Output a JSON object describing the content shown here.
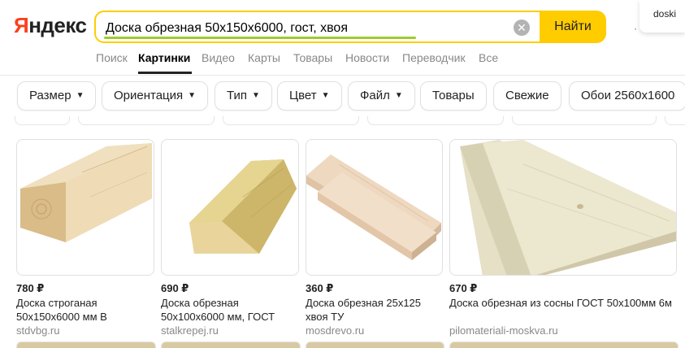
{
  "header": {
    "logo": {
      "first_letter": "Я",
      "rest": "ндекс"
    },
    "search": {
      "value": "Доска обрезная 50х150х6000, гост, хвоя",
      "clear_glyph": "✕",
      "submit_label": "Найти"
    },
    "suggestion": "doski"
  },
  "tabs": [
    {
      "label": "Поиск"
    },
    {
      "label": "Картинки",
      "active": true
    },
    {
      "label": "Видео"
    },
    {
      "label": "Карты"
    },
    {
      "label": "Товары"
    },
    {
      "label": "Новости"
    },
    {
      "label": "Переводчик"
    },
    {
      "label": "Все"
    }
  ],
  "filters": [
    {
      "label": "Размер",
      "dropdown": true
    },
    {
      "label": "Ориентация",
      "dropdown": true
    },
    {
      "label": "Тип",
      "dropdown": true
    },
    {
      "label": "Цвет",
      "dropdown": true
    },
    {
      "label": "Файл",
      "dropdown": true
    },
    {
      "label": "Товары",
      "dropdown": false
    },
    {
      "label": "Свежие",
      "dropdown": false
    },
    {
      "label": "Обои 2560x1600",
      "dropdown": false
    }
  ],
  "results": [
    {
      "price": "780 ₽",
      "title": "Доска строганая 50x150x6000 мм В",
      "domain": "stdvbg.ru"
    },
    {
      "price": "690 ₽",
      "title": "Доска обрезная 50x100x6000 мм, ГОСТ",
      "domain": "stalkrepej.ru"
    },
    {
      "price": "360 ₽",
      "title": "Доска обрезная 25x125 хвоя ТУ",
      "domain": "mosdrevo.ru"
    },
    {
      "price": "670 ₽",
      "title": "Доска обрезная из сосны ГОСТ 50х100мм 6м",
      "domain": "pilomateriali-moskva.ru"
    }
  ],
  "colors": {
    "accent_yellow": "#ffcc00",
    "logo_red": "#fc3f1d",
    "wood_light": "#ead9b8",
    "wood_mid": "#d8bf8e",
    "wood_dark": "#b8985f"
  }
}
